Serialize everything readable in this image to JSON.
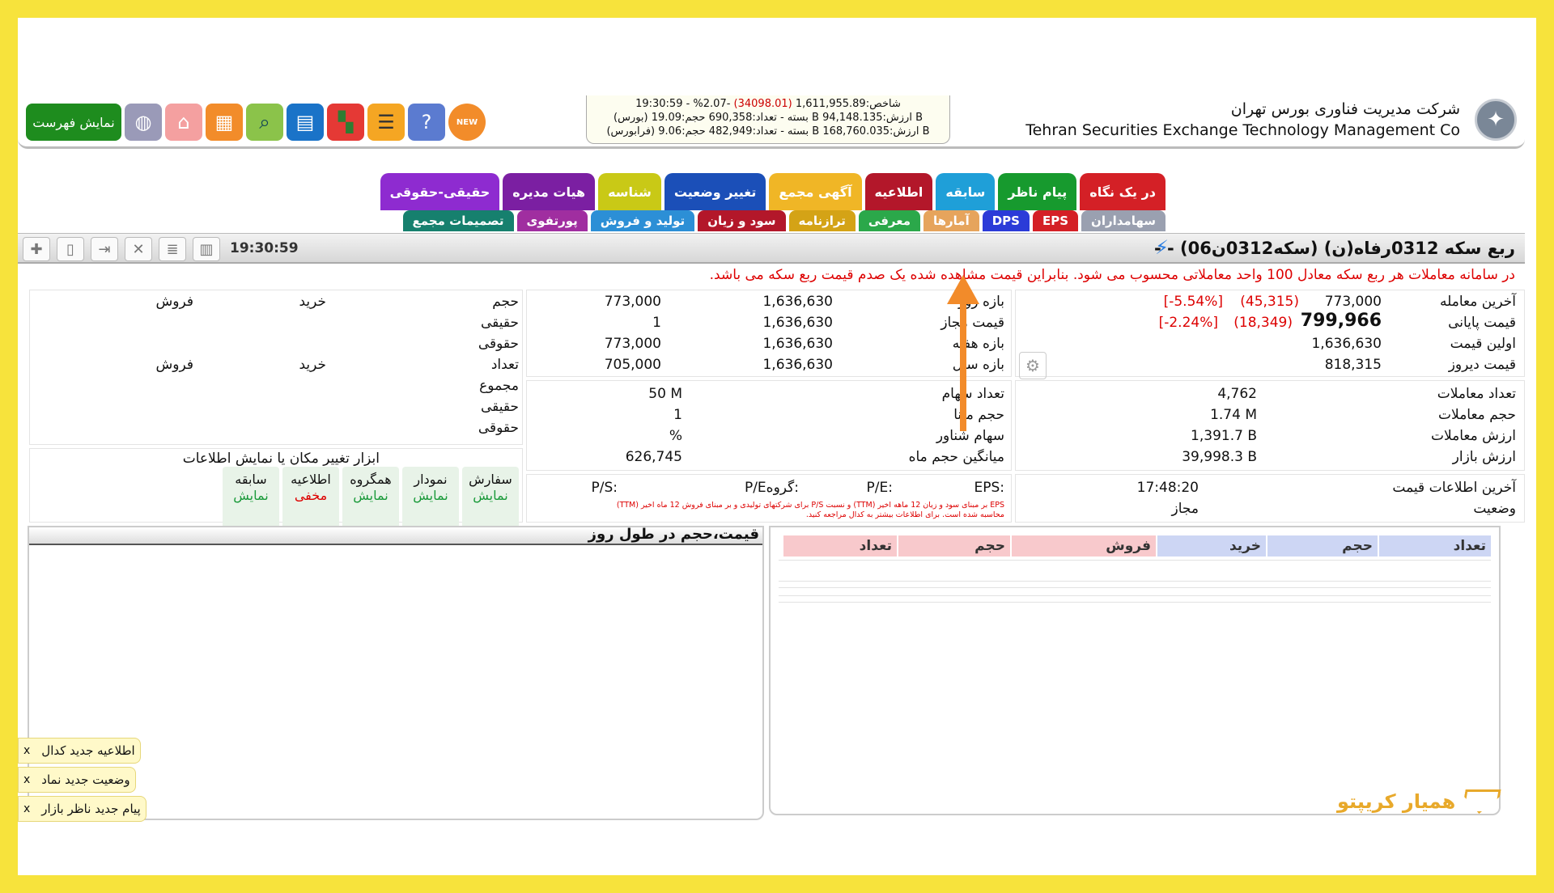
{
  "header": {
    "company_fa": "شرکت مدیریت فناوری بورس تهران",
    "company_en": "Tehran Securities Exchange Technology Management Co",
    "ticker": [
      {
        "pre": "19:30:59 - %2.07- ",
        "neg": "(34098.01)",
        "post": " 1,611,955.89:شاخص"
      },
      {
        "pre": "(بورس) بسته - تعداد:690,358 حجم:19.09 B ارزش:94,148.135 B",
        "neg": "",
        "post": ""
      },
      {
        "pre": "(فرابورس) بسته - تعداد:482,949 حجم:9.06 B ارزش:168,760.035 B",
        "neg": "",
        "post": ""
      }
    ],
    "show_list_label": "نمایش فهرست",
    "new_badge": "NEW"
  },
  "tabs_row1": [
    {
      "label": "در یک نگاه",
      "color": "#d42026"
    },
    {
      "label": "پیام ناظر",
      "color": "#179a2e"
    },
    {
      "label": "سابقه",
      "color": "#1f9fd8"
    },
    {
      "label": "اطلاعیه",
      "color": "#b3172a"
    },
    {
      "label": "آگهی مجمع",
      "color": "#f0b626"
    },
    {
      "label": "تغییر وضعیت",
      "color": "#1b4fb8"
    },
    {
      "label": "شناسه",
      "color": "#c9c916"
    },
    {
      "label": "هیات مدیره",
      "color": "#7b1fa2"
    },
    {
      "label": "حقیقی-حقوقی",
      "color": "#8e2bd0"
    }
  ],
  "tabs_row2": [
    {
      "label": "سهامداران",
      "color": "#9aa0b0"
    },
    {
      "label": "EPS",
      "color": "#d42026"
    },
    {
      "label": "DPS",
      "color": "#2b3bd8"
    },
    {
      "label": "آمارها",
      "color": "#e6a45c"
    },
    {
      "label": "معرفی",
      "color": "#2ba84a"
    },
    {
      "label": "ترازنامه",
      "color": "#d4a316"
    },
    {
      "label": "سود و زیان",
      "color": "#b3172a"
    },
    {
      "label": "تولید و فروش",
      "color": "#2c8fd6"
    },
    {
      "label": "پورتفوی",
      "color": "#a02ea0"
    },
    {
      "label": "تصمیمات مجمع",
      "color": "#16806e"
    }
  ],
  "titlebar": {
    "title": "ربع سکه 0312رفاه(ن) (سکه0312ن06) - -",
    "clock": "19:30:59"
  },
  "notice": "در سامانه معاملات هر ربع سکه معادل 100 واحد معاملاتی محسوب می شود. بنابراین قیمت مشاهده شده یک صدم قیمت ربع سکه می باشد.",
  "prices": {
    "last_trade_label": "آخرین معامله",
    "last_trade_value": "773,000",
    "last_trade_change": "(45,315)",
    "last_trade_pct": "[-5.54%]",
    "close_label": "قیمت پایانی",
    "close_value": "799,966",
    "close_change": "(18,349)",
    "close_pct": "[-2.24%]",
    "first_label": "اولین قیمت",
    "first_value": "1,636,630",
    "yesterday_label": "قیمت دیروز",
    "yesterday_value": "818,315"
  },
  "ranges": [
    {
      "label": "بازه روز",
      "a": "1,636,630",
      "b": "773,000"
    },
    {
      "label": "قیمت مجاز",
      "a": "1,636,630",
      "b": "1"
    },
    {
      "label": "بازه هفته",
      "a": "1,636,630",
      "b": "773,000"
    },
    {
      "label": "بازه سال",
      "a": "1,636,630",
      "b": "705,000"
    }
  ],
  "stats_right": [
    {
      "label": "تعداد معاملات",
      "value": "4,762"
    },
    {
      "label": "حجم معاملات",
      "value": "1.74 M"
    },
    {
      "label": "ارزش معاملات",
      "value": "1,391.7 B"
    },
    {
      "label": "ارزش بازار",
      "value": "39,998.3 B"
    }
  ],
  "stats_mid": [
    {
      "label": "تعداد سهام",
      "value": "50 M"
    },
    {
      "label": "حجم مبنا",
      "value": "1"
    },
    {
      "label": "سهام شناور",
      "value": "%"
    },
    {
      "label": "میانگین حجم ماه",
      "value": "626,745"
    }
  ],
  "info": {
    "last_info_label": "آخرین اطلاعات قیمت",
    "last_info_value": "17:48:20",
    "status_label": "وضعیت",
    "status_value": "مجاز"
  },
  "ratios": {
    "eps": "EPS:",
    "pe": "P/E:",
    "group_pe": "P/Eگروه:",
    "ps": "P/S:",
    "note1": "EPS بر مبنای سود و زیان 12 ماهه اخیر (TTM) و نسبت P/S برای شرکتهای تولیدی و بر مبنای فروش 12 ماه اخیر (TTM)",
    "note2": "محاسبه شده است. برای اطلاعات بیشتر به کدال مراجعه کنید."
  },
  "client": {
    "volume": "حجم",
    "buy": "خرید",
    "sell": "فروش",
    "haghighi": "حقیقی",
    "hoghooghi": "حقوقی",
    "count": "تعداد",
    "total": "مجموع"
  },
  "layout_tools": {
    "title": "ابزار تغییر مکان یا نمایش اطلاعات",
    "items": [
      {
        "name": "سفارش",
        "state": "نمایش",
        "hidden": false
      },
      {
        "name": "نمودار",
        "state": "نمایش",
        "hidden": false
      },
      {
        "name": "همگروه",
        "state": "نمایش",
        "hidden": false
      },
      {
        "name": "اطلاعیه",
        "state": "مخفی",
        "hidden": true
      },
      {
        "name": "سابقه",
        "state": "نمایش",
        "hidden": false
      }
    ]
  },
  "orderbook": {
    "headers_buy": [
      "تعداد",
      "حجم",
      "خرید"
    ],
    "headers_sell": [
      "فروش",
      "حجم",
      "تعداد"
    ]
  },
  "chart": {
    "title": "قیمت،حجم در طول روز"
  },
  "toasts": [
    {
      "text": "اطلاعیه جدید کدال",
      "close": "x"
    },
    {
      "text": "وضعیت جدید نماد",
      "close": "x"
    },
    {
      "text": "پیام جدید ناظر بازار",
      "close": "x"
    }
  ],
  "brand": {
    "text": "همیار کریپتو"
  }
}
